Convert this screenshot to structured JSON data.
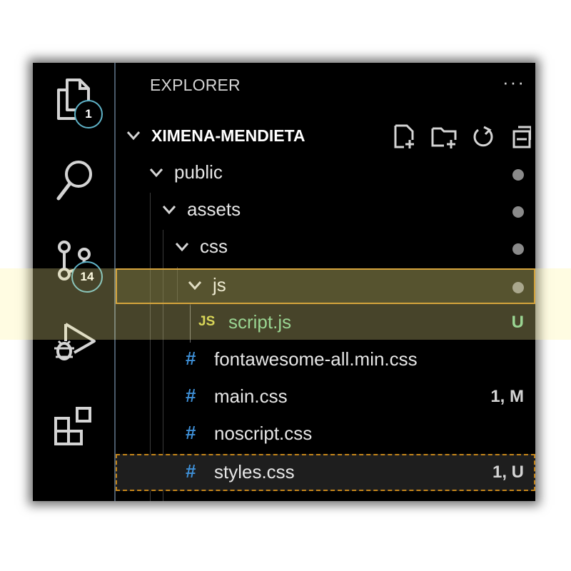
{
  "activity_bar": {
    "explorer_badge": "1",
    "scm_badge": "14",
    "icons": [
      "files-icon",
      "search-icon",
      "source-control-icon",
      "run-debug-icon",
      "extensions-icon"
    ]
  },
  "explorer": {
    "title": "EXPLORER",
    "more": "···",
    "root": "XIMENA-MENDIETA",
    "toolbar": [
      "new-file-icon",
      "new-folder-icon",
      "refresh-icon",
      "collapse-icon"
    ],
    "tree": {
      "public": "public",
      "assets": "assets",
      "css": "css",
      "js": "js",
      "script_js": "script.js",
      "script_js_icon": "JS",
      "script_js_status": "U",
      "fontawesome": "fontawesome-all.min.css",
      "main_css": "main.css",
      "main_css_status": "1, M",
      "noscript_css": "noscript.css",
      "styles_css": "styles.css",
      "styles_css_status": "1, U",
      "css_icon": "#"
    }
  },
  "colors": {
    "background": "#000000",
    "untracked_green": "#73c991",
    "js_yellow": "#cbcb41",
    "css_blue": "#3e8fd6",
    "badge_border": "#5fb3c8",
    "highlight_orange": "#c5851a"
  }
}
